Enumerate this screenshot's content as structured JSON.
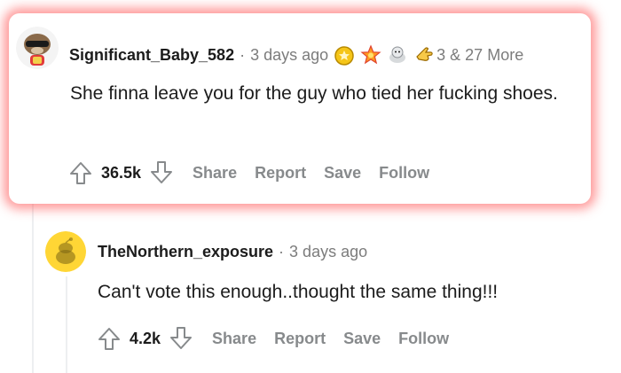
{
  "comments": [
    {
      "username": "Significant_Baby_582",
      "separator": "·",
      "time": "3 days ago",
      "awards": [
        "gold-award-icon",
        "star-award-icon",
        "wholesome-seal-icon",
        "pointing-hand-award-icon"
      ],
      "more_awards": "3 & 27 More",
      "body": "She finna leave you for the guy who tied her fucking shoes.",
      "score": "36.5k",
      "actions": {
        "share": "Share",
        "report": "Report",
        "save": "Save",
        "follow": "Follow"
      }
    },
    {
      "username": "TheNorthern_exposure",
      "separator": "·",
      "time": "3 days ago",
      "body": "Can't vote this enough..thought the same thing!!!",
      "score": "4.2k",
      "actions": {
        "share": "Share",
        "report": "Report",
        "save": "Save",
        "follow": "Follow"
      }
    }
  ],
  "colors": {
    "highlight_glow": "#ff4646",
    "meta_gray": "#7c7c7c",
    "action_gray": "#878a8c",
    "reply_avatar_bg": "#ffd635"
  }
}
